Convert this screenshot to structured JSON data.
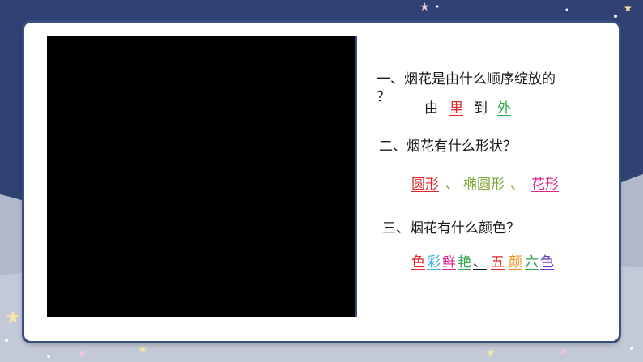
{
  "colors": {
    "background_top": "#2f4273",
    "background_bottom": "#c4c9d8",
    "card": "#ffffff",
    "card_border": "#3a4e82",
    "red": "#e0262b",
    "green": "#2ea84a",
    "olive_green": "#7fa83a",
    "pink": "#d42a8c",
    "sky": "#36b4e6",
    "orange": "#f08c1e",
    "purple": "#6a3dbf"
  },
  "video": {
    "state": "black-frame"
  },
  "q1": {
    "line1": "一、烟花是由什么顺序绽放的",
    "line2": "？",
    "answer": {
      "pre": "由",
      "w1": "里",
      "mid": "到",
      "w2": "外"
    }
  },
  "q2": {
    "question": "二、烟花有什么形状？",
    "answer": {
      "w1": "圆形",
      "sep1": "、",
      "w2": "椭圆形",
      "sep2": "、",
      "w3": "花形"
    }
  },
  "q3": {
    "question": "三、烟花有什么颜色？",
    "answer": {
      "c1": "色",
      "c2": "彩",
      "c3": "鲜",
      "c4": "艳",
      "c5": "、",
      "c6": "五",
      "c7": "颜",
      "c8": "六",
      "c9": "色"
    }
  }
}
